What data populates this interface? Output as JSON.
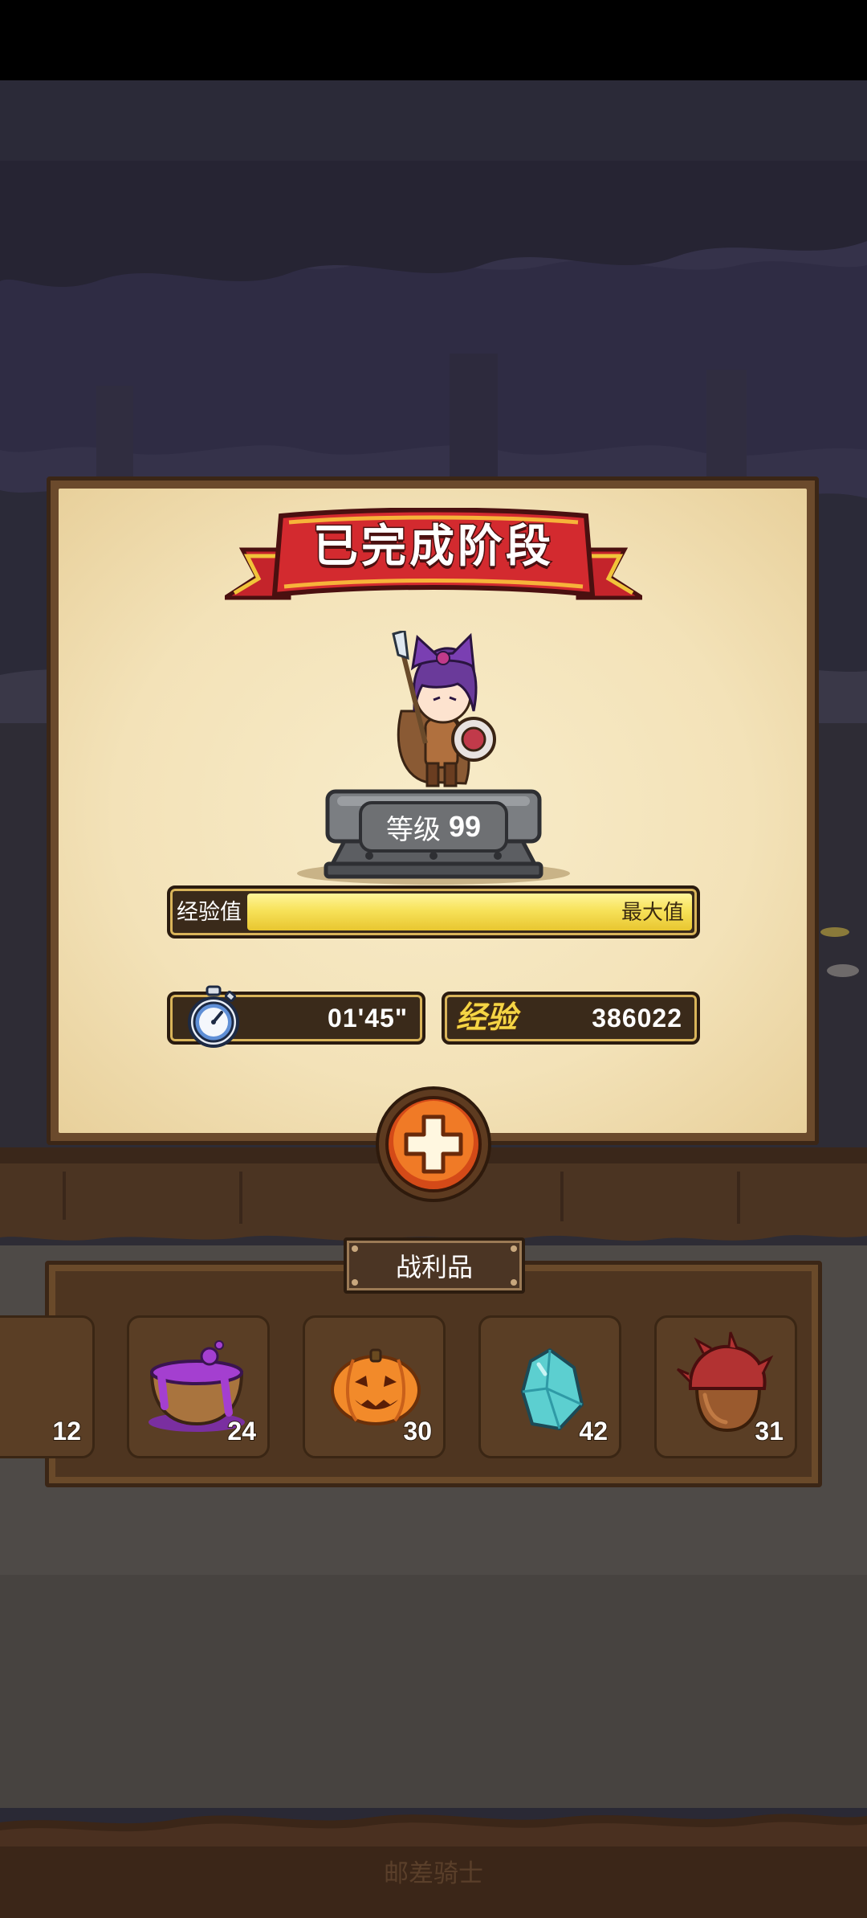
{
  "result": {
    "title": "已完成阶段",
    "level_label": "等级",
    "level_value": "99",
    "exp_bar_label": "经验值",
    "exp_bar_status": "最大值",
    "exp_fraction": 1.0,
    "time": "01'45\"",
    "exp_word": "经验",
    "exp_value": "386022"
  },
  "loot": {
    "title": "战利品",
    "items": [
      {
        "icon": "partial-item-icon",
        "count": "12"
      },
      {
        "icon": "purple-potion-bowl-icon",
        "count": "24"
      },
      {
        "icon": "pumpkin-icon",
        "count": "30"
      },
      {
        "icon": "cyan-crystal-icon",
        "count": "42"
      },
      {
        "icon": "spiked-acorn-icon",
        "count": "31"
      }
    ]
  },
  "footer": {
    "text": "邮差骑士"
  },
  "colors": {
    "banner_red": "#c4242b",
    "parchment": "#f3e2b8",
    "exp_fill": "#f7e25a",
    "plus_orange": "#e8661a",
    "wood_dark": "#3b2616"
  }
}
